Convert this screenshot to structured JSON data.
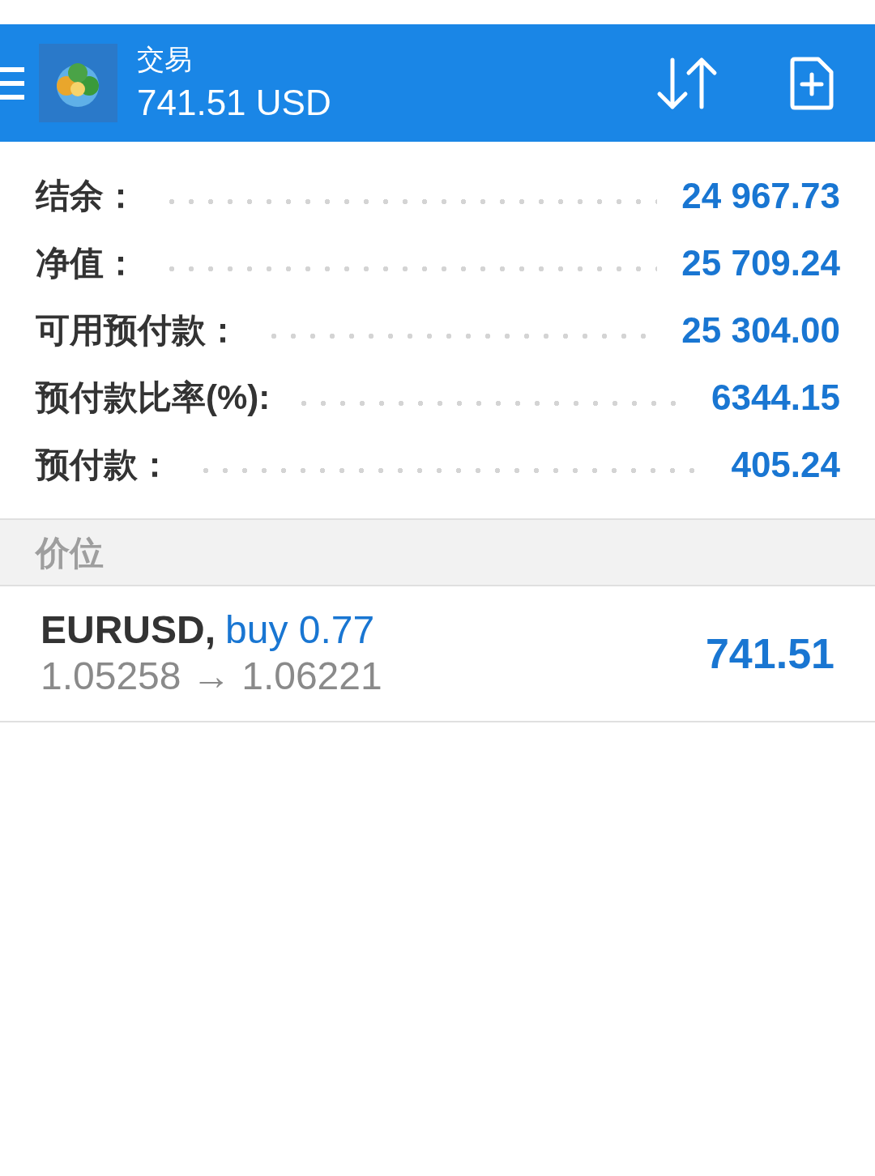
{
  "header": {
    "title": "交易",
    "subtitle": "741.51 USD"
  },
  "summary": [
    {
      "label": "结余：",
      "value": "24 967.73"
    },
    {
      "label": "净值：",
      "value": "25 709.24"
    },
    {
      "label": "可用预付款：",
      "value": "25 304.00"
    },
    {
      "label": "预付款比率(%):",
      "value": "6344.15"
    },
    {
      "label": "预付款：",
      "value": "405.24"
    }
  ],
  "section": {
    "title": "价位"
  },
  "positions": [
    {
      "symbol": "EURUSD,",
      "order": "buy 0.77",
      "prices": "1.05258 → 1.06221",
      "profit": "741.51"
    }
  ]
}
